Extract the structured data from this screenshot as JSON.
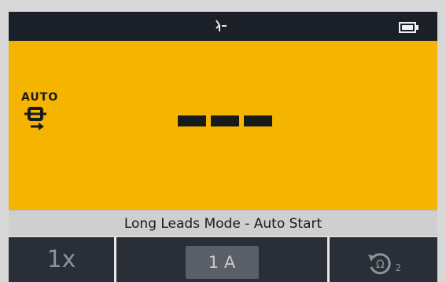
{
  "status_bar": {
    "signal_icon": "signal-antenna-icon",
    "battery_icon": "battery-icon"
  },
  "display": {
    "auto_label": "AUTO",
    "mode_icon": "long-leads-probe-icon",
    "reading": "---"
  },
  "mode_bar": {
    "text": "Long Leads Mode - Auto Start"
  },
  "softkeys": {
    "multiplier": "1x",
    "range": "1 A",
    "lock_icon": "ohm-lock-icon",
    "lock_subscript": "2"
  },
  "colors": {
    "display_background": "#f4b400",
    "status_bar": "#1b1f28",
    "softkey_background": "#2a2e36",
    "mode_bar": "#cfcfcf"
  }
}
